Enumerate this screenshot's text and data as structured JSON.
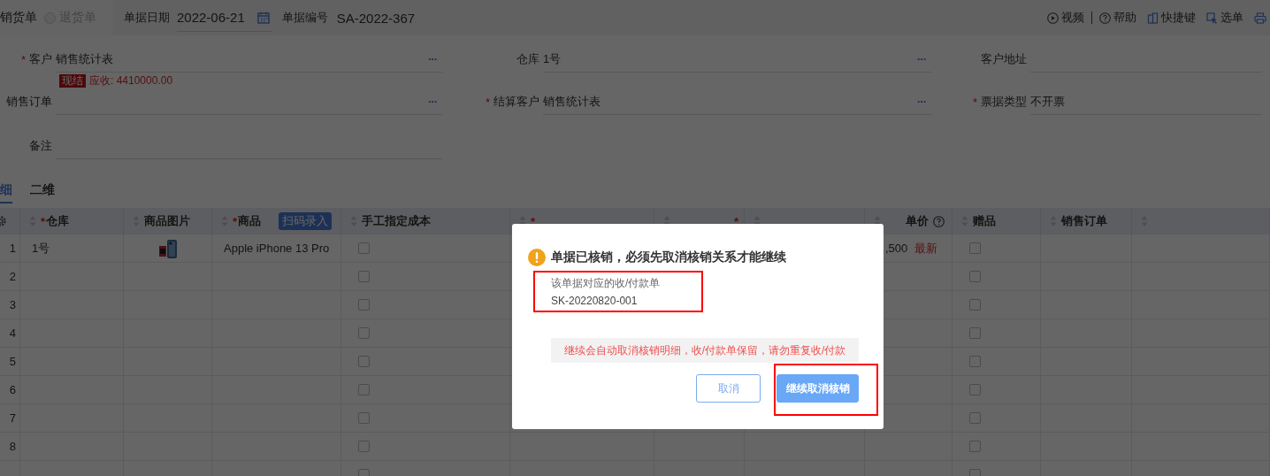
{
  "header": {
    "order_types": [
      {
        "label": "销货单",
        "selected": true
      },
      {
        "label": "退货单",
        "selected": false
      }
    ],
    "date_label": "单据日期",
    "date_value": "2022-06-21",
    "number_label": "单据编号",
    "number_value": "SA-2022-367",
    "toolbar": [
      {
        "kind": "video",
        "label": "视频"
      },
      {
        "kind": "help",
        "label": "帮助"
      },
      {
        "kind": "shortcut",
        "label": "快捷键"
      },
      {
        "kind": "select",
        "label": "选单"
      },
      {
        "kind": "print"
      }
    ]
  },
  "form": {
    "rows": [
      [
        {
          "label": "客户",
          "required_mark": "*",
          "value": "销售统计表",
          "picker": "···"
        },
        {
          "label": "仓库",
          "value": "1号",
          "picker": "···"
        },
        {
          "label": "客户地址"
        }
      ],
      [
        {
          "label": "销售订单",
          "picker": "···"
        },
        {
          "label": "结算客户",
          "required_mark": "*",
          "value": "销售统计表",
          "picker": "···"
        },
        {
          "label": "票据类型",
          "required_mark": "*",
          "value": "不开票"
        }
      ],
      [
        {
          "label": "备注"
        }
      ]
    ],
    "customer_tag": "现结",
    "receivable": "应收: 4410000.00"
  },
  "detail_tabs": [
    {
      "label": "细",
      "selected": true
    },
    {
      "label": "二维",
      "selected": false
    }
  ],
  "table": {
    "columns": [
      {
        "kind": "settings"
      },
      {
        "kind": "text",
        "label": "仓库",
        "required_mark": "*"
      },
      {
        "kind": "text",
        "label": "商品图片"
      },
      {
        "kind": "text",
        "label": "商品",
        "required_mark": "*",
        "badge": "扫码录入"
      },
      {
        "kind": "text",
        "label": "手工指定成本"
      },
      {
        "kind": "text",
        "required_mark": "*"
      },
      {
        "kind": "right",
        "required_mark": "*"
      },
      {
        "kind": "text"
      },
      {
        "kind": "help",
        "label": "单价"
      },
      {
        "kind": "text",
        "label": "赠品"
      },
      {
        "kind": "text",
        "label": "销售订单"
      },
      {
        "kind": "text"
      }
    ],
    "rows": [
      {
        "num": "1",
        "warehouse": "1号",
        "image": true,
        "product": "Apple iPhone 13 Pro",
        "manual_cost_checked": false,
        "price": ",500",
        "price_tag": "最新",
        "gift_checked": false
      },
      {
        "num": "2",
        "manual_cost_checked": false,
        "gift_checked": false
      },
      {
        "num": "3",
        "manual_cost_checked": false,
        "gift_checked": false
      },
      {
        "num": "4",
        "manual_cost_checked": false,
        "gift_checked": false
      },
      {
        "num": "5",
        "manual_cost_checked": false,
        "gift_checked": false
      },
      {
        "num": "6",
        "manual_cost_checked": false,
        "gift_checked": false
      },
      {
        "num": "7",
        "manual_cost_checked": false,
        "gift_checked": false
      },
      {
        "num": "8",
        "manual_cost_checked": false,
        "gift_checked": false
      },
      {
        "manual_cost_checked": false,
        "gift_checked": false
      }
    ]
  },
  "dialog": {
    "title": "单据已核销，必须先取消核销关系才能继续",
    "ref_label": "该单据对应的收/付款单",
    "ref_number": "SK-20220820-001",
    "notice": "继续会自动取消核销明细，收/付款单保留，请勿重复收/付款",
    "buttons": [
      {
        "kind": "secondary",
        "label": "取消"
      },
      {
        "kind": "primary",
        "label": "继续取消核销"
      }
    ]
  }
}
